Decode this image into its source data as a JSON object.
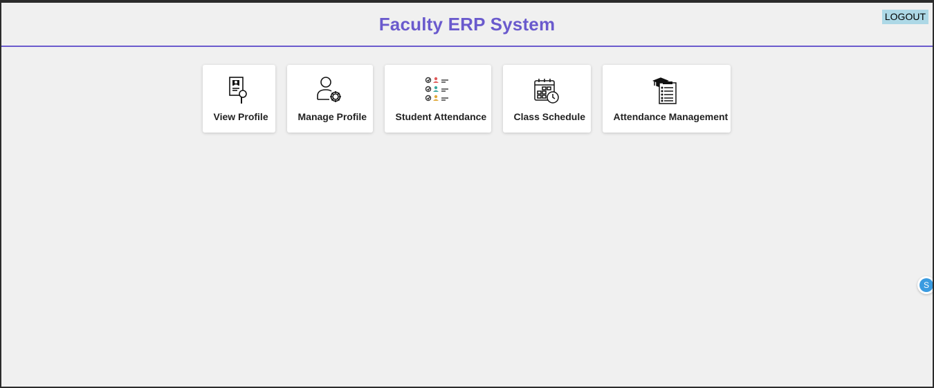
{
  "header": {
    "title": "Faculty ERP System",
    "logout_label": "LOGOUT"
  },
  "cards": [
    {
      "label": "View Profile",
      "icon": "profile-document-magnifier-icon"
    },
    {
      "label": "Manage Profile",
      "icon": "user-gear-icon"
    },
    {
      "label": "Student Attendance",
      "icon": "attendance-checklist-icon"
    },
    {
      "label": "Class Schedule",
      "icon": "calendar-clock-icon"
    },
    {
      "label": "Attendance Management",
      "icon": "graduation-cap-clipboard-icon"
    }
  ],
  "side_widget": {
    "letter": "S"
  },
  "colors": {
    "accent": "#6a5acd",
    "background": "#f0f0f0",
    "logout_bg": "#add8e6",
    "widget": "#3a9be0"
  }
}
